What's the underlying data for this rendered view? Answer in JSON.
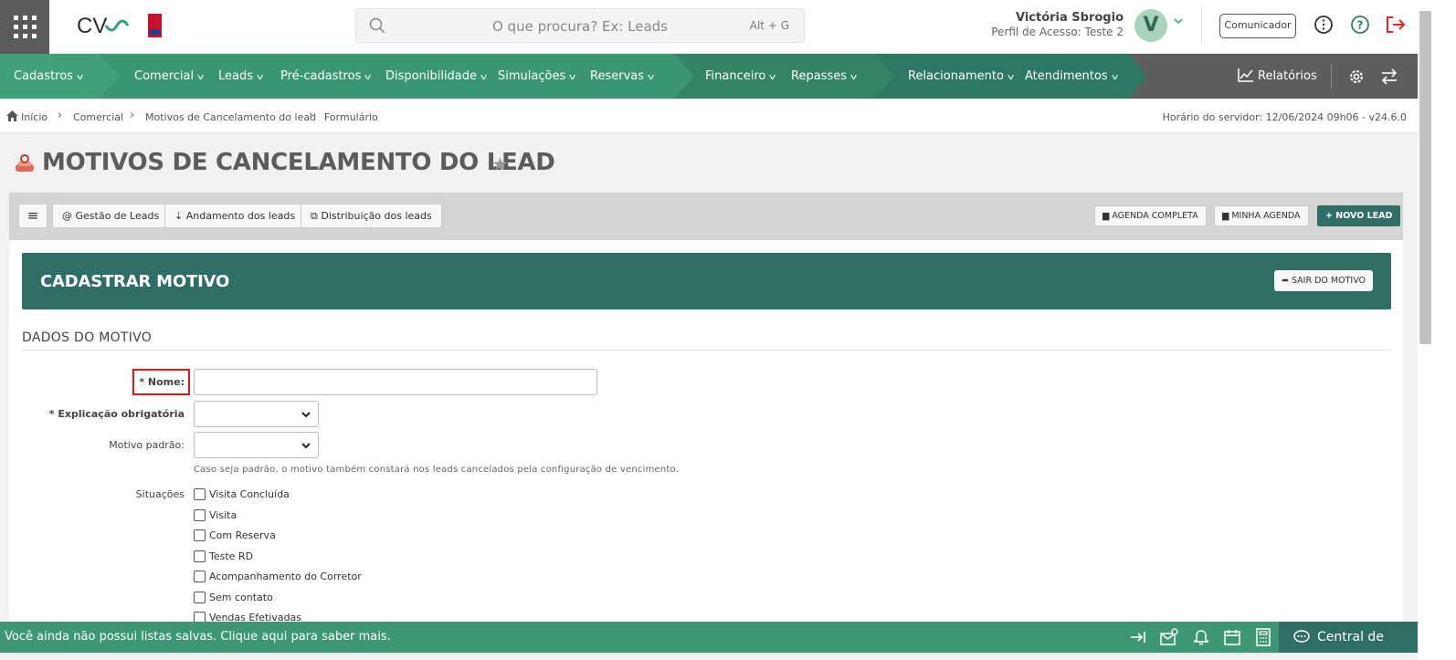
{
  "header": {
    "search_placeholder": "O que procura? Ex: Leads",
    "search_shortcut": "Alt + G",
    "user_name": "Victória Sbrogio",
    "user_profile": "Perfil de Acesso: Teste 2",
    "avatar_letter": "V",
    "communicator_label": "Comunicador",
    "logo_text": "CV"
  },
  "nav": {
    "items": [
      {
        "label": "Cadastros"
      },
      {
        "label": "Comercial"
      },
      {
        "label": "Leads"
      },
      {
        "label": "Pré-cadastros"
      },
      {
        "label": "Disponibilidade"
      },
      {
        "label": "Simulações"
      },
      {
        "label": "Reservas"
      },
      {
        "label": "Financeiro"
      },
      {
        "label": "Repasses"
      },
      {
        "label": "Relacionamento"
      },
      {
        "label": "Atendimentos"
      }
    ],
    "reports_label": "Relatórios",
    "colors": {
      "seg1": "#41a07a",
      "seg2": "#3b9673",
      "seg3": "#338466",
      "seg4": "#2e7760",
      "rest": "#5d5d5d"
    }
  },
  "breadcrumb": {
    "items": [
      "Início",
      "Comercial",
      "Motivos de Cancelamento do lead",
      "Formulário"
    ],
    "server_time": "Horário do servidor: 12/06/2024 09h06 - v24.6.0"
  },
  "page": {
    "title": "MOTIVOS DE CANCELAMENTO DO LEAD"
  },
  "toolbar": {
    "menu_icon": "≡",
    "left_buttons": [
      "Gestão de Leads",
      "Andamento dos leads",
      "Distribuição dos leads"
    ],
    "agenda_completa": "AGENDA COMPLETA",
    "minha_agenda": "MINHA AGENDA",
    "novo_lead": "NOVO LEAD"
  },
  "form": {
    "header_title": "CADASTRAR MOTIVO",
    "exit_label": "SAIR DO MOTIVO",
    "section_title": "DADOS DO MOTIVO",
    "nome_label": "* Nome:",
    "nome_value": "",
    "explicacao_label": "* Explicação obrigatória",
    "explicacao_value": "",
    "motivo_padrao_label": "Motivo padrão:",
    "motivo_padrao_value": "",
    "hint": "Caso seja padrão, o motivo também constará nos leads cancelados pela configuração de vencimento.",
    "situacoes_label": "Situações",
    "situacoes": [
      {
        "label": "Visita Concluída",
        "checked": false
      },
      {
        "label": "Visita",
        "checked": false
      },
      {
        "label": "Com Reserva",
        "checked": false
      },
      {
        "label": "Teste RD",
        "checked": false
      },
      {
        "label": "Acompanhamento do Corretor",
        "checked": false
      },
      {
        "label": "Sem contato",
        "checked": false
      },
      {
        "label": "Vendas Efetivadas",
        "checked": false
      }
    ]
  },
  "bottombar": {
    "message": "Você ainda não possui listas salvas. Clique aqui para saber mais.",
    "help_label": "Central de Ajuda"
  }
}
